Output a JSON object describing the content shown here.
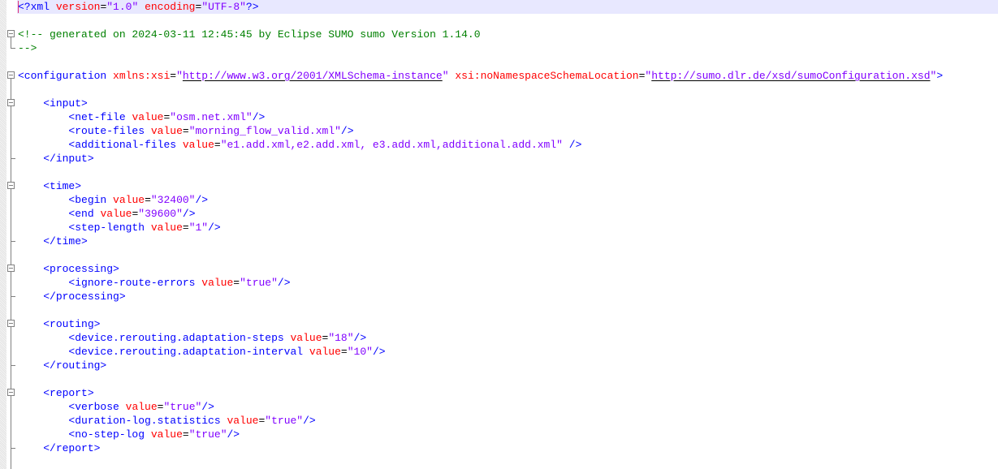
{
  "editor": {
    "current_line": 1,
    "lines": [
      {
        "fold": "none",
        "tokens": [
          [
            "t",
            "<?"
          ],
          [
            "t",
            "xml"
          ],
          [
            "p",
            " "
          ],
          [
            "a",
            "version"
          ],
          [
            "e",
            "="
          ],
          [
            "v",
            "\"1.0\""
          ],
          [
            "p",
            " "
          ],
          [
            "a",
            "encoding"
          ],
          [
            "e",
            "="
          ],
          [
            "v",
            "\"UTF-8\""
          ],
          [
            "t",
            "?>"
          ]
        ]
      },
      {
        "fold": "none",
        "tokens": []
      },
      {
        "fold": "open",
        "tokens": [
          [
            "c",
            "<!-- generated on 2024-03-11 12:45:45 by Eclipse SUMO sumo Version 1.14.0"
          ]
        ]
      },
      {
        "fold": "last",
        "tokens": [
          [
            "c",
            "-->"
          ]
        ]
      },
      {
        "fold": "none",
        "tokens": []
      },
      {
        "fold": "open",
        "tokens": [
          [
            "t",
            "<configuration"
          ],
          [
            "p",
            " "
          ],
          [
            "a",
            "xmlns:xsi"
          ],
          [
            "e",
            "="
          ],
          [
            "v",
            "\""
          ],
          [
            "u",
            "http://www.w3.org/2001/XMLSchema-instance"
          ],
          [
            "v",
            "\""
          ],
          [
            "p",
            " "
          ],
          [
            "a",
            "xsi:noNamespaceSchemaLocation"
          ],
          [
            "e",
            "="
          ],
          [
            "v",
            "\""
          ],
          [
            "u",
            "http://sumo.dlr.de/xsd/sumoConfiguration.xsd"
          ],
          [
            "v",
            "\""
          ],
          [
            "t",
            ">"
          ]
        ]
      },
      {
        "fold": "line",
        "tokens": []
      },
      {
        "fold": "open2",
        "tokens": [
          [
            "p",
            "    "
          ],
          [
            "t",
            "<input>"
          ]
        ]
      },
      {
        "fold": "line",
        "tokens": [
          [
            "p",
            "        "
          ],
          [
            "t",
            "<net-file"
          ],
          [
            "p",
            " "
          ],
          [
            "a",
            "value"
          ],
          [
            "e",
            "="
          ],
          [
            "v",
            "\"osm.net.xml\""
          ],
          [
            "t",
            "/>"
          ]
        ]
      },
      {
        "fold": "line",
        "tokens": [
          [
            "p",
            "        "
          ],
          [
            "t",
            "<route-files"
          ],
          [
            "p",
            " "
          ],
          [
            "a",
            "value"
          ],
          [
            "e",
            "="
          ],
          [
            "v",
            "\"morning_flow_valid.xml\""
          ],
          [
            "t",
            "/>"
          ]
        ]
      },
      {
        "fold": "line",
        "tokens": [
          [
            "p",
            "        "
          ],
          [
            "t",
            "<additional-files"
          ],
          [
            "p",
            " "
          ],
          [
            "a",
            "value"
          ],
          [
            "e",
            "="
          ],
          [
            "v",
            "\"e1.add.xml,e2.add.xml, e3.add.xml,additional.add.xml\""
          ],
          [
            "p",
            " "
          ],
          [
            "t",
            "/>"
          ]
        ]
      },
      {
        "fold": "end",
        "tokens": [
          [
            "p",
            "    "
          ],
          [
            "t",
            "</input>"
          ]
        ]
      },
      {
        "fold": "line",
        "tokens": []
      },
      {
        "fold": "open2",
        "tokens": [
          [
            "p",
            "    "
          ],
          [
            "t",
            "<time>"
          ]
        ]
      },
      {
        "fold": "line",
        "tokens": [
          [
            "p",
            "        "
          ],
          [
            "t",
            "<begin"
          ],
          [
            "p",
            " "
          ],
          [
            "a",
            "value"
          ],
          [
            "e",
            "="
          ],
          [
            "v",
            "\"32400\""
          ],
          [
            "t",
            "/>"
          ]
        ]
      },
      {
        "fold": "line",
        "tokens": [
          [
            "p",
            "        "
          ],
          [
            "t",
            "<end"
          ],
          [
            "p",
            " "
          ],
          [
            "a",
            "value"
          ],
          [
            "e",
            "="
          ],
          [
            "v",
            "\"39600\""
          ],
          [
            "t",
            "/>"
          ]
        ]
      },
      {
        "fold": "line",
        "tokens": [
          [
            "p",
            "        "
          ],
          [
            "t",
            "<step-length"
          ],
          [
            "p",
            " "
          ],
          [
            "a",
            "value"
          ],
          [
            "e",
            "="
          ],
          [
            "v",
            "\"1\""
          ],
          [
            "t",
            "/>"
          ]
        ]
      },
      {
        "fold": "end",
        "tokens": [
          [
            "p",
            "    "
          ],
          [
            "t",
            "</time>"
          ]
        ]
      },
      {
        "fold": "line",
        "tokens": []
      },
      {
        "fold": "open2",
        "tokens": [
          [
            "p",
            "    "
          ],
          [
            "t",
            "<processing>"
          ]
        ]
      },
      {
        "fold": "line",
        "tokens": [
          [
            "p",
            "        "
          ],
          [
            "t",
            "<ignore-route-errors"
          ],
          [
            "p",
            " "
          ],
          [
            "a",
            "value"
          ],
          [
            "e",
            "="
          ],
          [
            "v",
            "\"true\""
          ],
          [
            "t",
            "/>"
          ]
        ]
      },
      {
        "fold": "end",
        "tokens": [
          [
            "p",
            "    "
          ],
          [
            "t",
            "</processing>"
          ]
        ]
      },
      {
        "fold": "line",
        "tokens": []
      },
      {
        "fold": "open2",
        "tokens": [
          [
            "p",
            "    "
          ],
          [
            "t",
            "<routing>"
          ]
        ]
      },
      {
        "fold": "line",
        "tokens": [
          [
            "p",
            "        "
          ],
          [
            "t",
            "<device.rerouting.adaptation-steps"
          ],
          [
            "p",
            " "
          ],
          [
            "a",
            "value"
          ],
          [
            "e",
            "="
          ],
          [
            "v",
            "\"18\""
          ],
          [
            "t",
            "/>"
          ]
        ]
      },
      {
        "fold": "line",
        "tokens": [
          [
            "p",
            "        "
          ],
          [
            "t",
            "<device.rerouting.adaptation-interval"
          ],
          [
            "p",
            " "
          ],
          [
            "a",
            "value"
          ],
          [
            "e",
            "="
          ],
          [
            "v",
            "\"10\""
          ],
          [
            "t",
            "/>"
          ]
        ]
      },
      {
        "fold": "end",
        "tokens": [
          [
            "p",
            "    "
          ],
          [
            "t",
            "</routing>"
          ]
        ]
      },
      {
        "fold": "line",
        "tokens": []
      },
      {
        "fold": "open2",
        "tokens": [
          [
            "p",
            "    "
          ],
          [
            "t",
            "<report>"
          ]
        ]
      },
      {
        "fold": "line",
        "tokens": [
          [
            "p",
            "        "
          ],
          [
            "t",
            "<verbose"
          ],
          [
            "p",
            " "
          ],
          [
            "a",
            "value"
          ],
          [
            "e",
            "="
          ],
          [
            "v",
            "\"true\""
          ],
          [
            "t",
            "/>"
          ]
        ]
      },
      {
        "fold": "line",
        "tokens": [
          [
            "p",
            "        "
          ],
          [
            "t",
            "<duration-log.statistics"
          ],
          [
            "p",
            " "
          ],
          [
            "a",
            "value"
          ],
          [
            "e",
            "="
          ],
          [
            "v",
            "\"true\""
          ],
          [
            "t",
            "/>"
          ]
        ]
      },
      {
        "fold": "line",
        "tokens": [
          [
            "p",
            "        "
          ],
          [
            "t",
            "<no-step-log"
          ],
          [
            "p",
            " "
          ],
          [
            "a",
            "value"
          ],
          [
            "e",
            "="
          ],
          [
            "v",
            "\"true\""
          ],
          [
            "t",
            "/>"
          ]
        ]
      },
      {
        "fold": "end",
        "tokens": [
          [
            "p",
            "    "
          ],
          [
            "t",
            "</report>"
          ]
        ]
      },
      {
        "fold": "line",
        "tokens": []
      }
    ]
  }
}
